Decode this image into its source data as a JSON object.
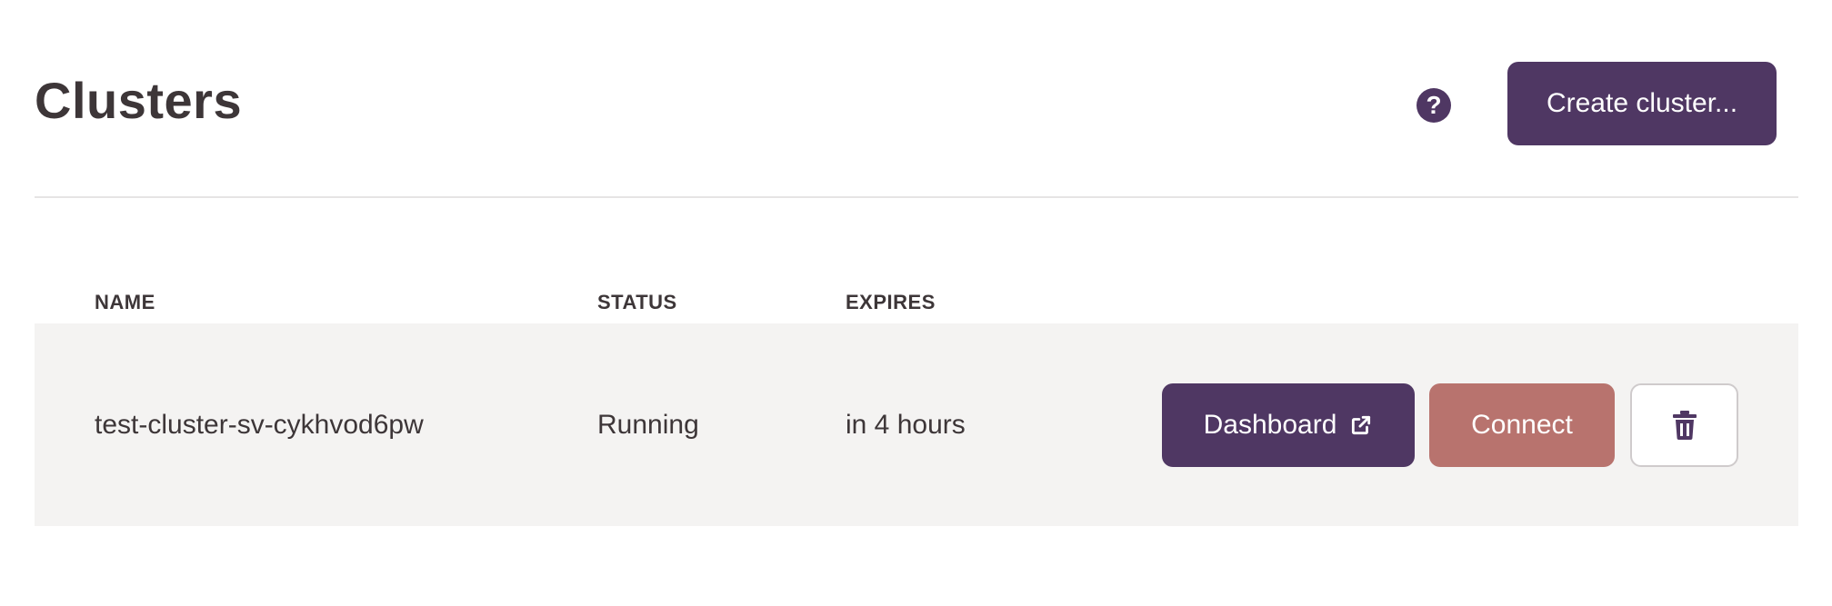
{
  "header": {
    "title": "Clusters",
    "help_icon": "question-circle-icon",
    "create_button_label": "Create cluster..."
  },
  "table": {
    "columns": [
      "NAME",
      "STATUS",
      "EXPIRES"
    ],
    "rows": [
      {
        "name": "test-cluster-sv-cykhvod6pw",
        "status": "Running",
        "expires": "in 4 hours",
        "actions": {
          "dashboard_label": "Dashboard",
          "dashboard_icon": "external-link-icon",
          "connect_label": "Connect",
          "delete_icon": "trash-icon"
        }
      }
    ]
  },
  "colors": {
    "primary": "#4f3763",
    "connect": "#b8736e",
    "row_background": "#f4f3f2",
    "text": "#3d3638"
  }
}
